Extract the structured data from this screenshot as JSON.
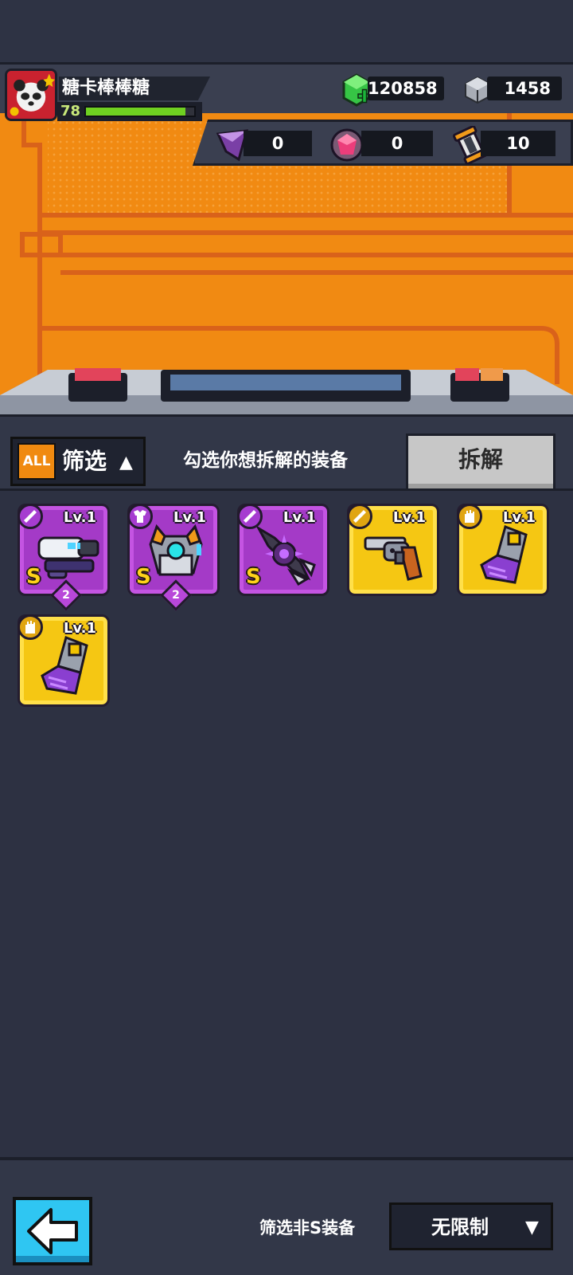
{
  "player": {
    "name": "糖卡棒棒糖",
    "level": "78",
    "xp_fraction": 0.92
  },
  "currencies": {
    "gems": "120858",
    "cubes": "1458"
  },
  "resources": [
    {
      "icon": "purple-shard-icon",
      "value": "0"
    },
    {
      "icon": "pink-gem-icon",
      "value": "0"
    },
    {
      "icon": "scroll-capsule-icon",
      "value": "10"
    }
  ],
  "toolbar": {
    "all_badge": "ALL",
    "filter_label": "筛选",
    "filter_arrow": "▲",
    "hint": "勾选你想拆解的装备",
    "dismantle_label": "拆解"
  },
  "inventory": [
    {
      "name": "laser-blaster",
      "rarity": "purple",
      "level": "Lv.1",
      "grade": "S",
      "stack": "2",
      "type_icon": "sword-icon"
    },
    {
      "name": "mech-armor",
      "rarity": "purple",
      "level": "Lv.1",
      "grade": "S",
      "stack": "2",
      "type_icon": "armor-icon"
    },
    {
      "name": "saw-blade-weapon",
      "rarity": "purple",
      "level": "Lv.1",
      "grade": "S",
      "stack": "",
      "type_icon": "sword-icon"
    },
    {
      "name": "revolver",
      "rarity": "gold",
      "level": "Lv.1",
      "grade": "",
      "stack": "",
      "type_icon": "sword-icon"
    },
    {
      "name": "power-gauntlet",
      "rarity": "gold",
      "level": "Lv.1",
      "grade": "",
      "stack": "",
      "type_icon": "glove-icon"
    },
    {
      "name": "power-gauntlet",
      "rarity": "gold",
      "level": "Lv.1",
      "grade": "",
      "stack": "",
      "type_icon": "glove-icon"
    }
  ],
  "bottom": {
    "filter_label": "筛选非S装备",
    "limit_value": "无限制",
    "limit_arrow": "▼"
  },
  "colors": {
    "background": "#2d3142",
    "backdrop_orange": "#f18a12",
    "rarity_purple": "#a43ac7",
    "rarity_gold": "#f5c713",
    "back_button": "#2fc6f2",
    "xp_green": "#6fd021"
  }
}
